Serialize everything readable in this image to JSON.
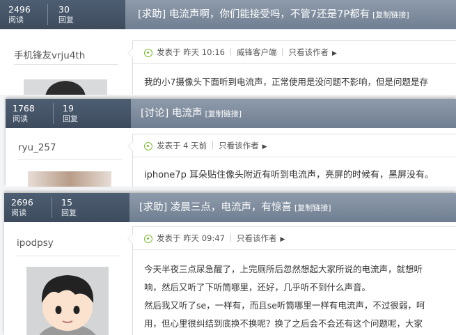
{
  "threads": [
    {
      "views": "2496",
      "views_label": "阅读",
      "replies": "30",
      "replies_label": "回复",
      "title": "[求助] 电流声啊，你们能接受吗，不管7还是7P都有",
      "copy_link": "[复制链接]",
      "author": "手机锋友vrju4th",
      "posted": "发表于 昨天 10:16",
      "client": "威锋客户端",
      "author_only": "只看该作者",
      "body_lines": [
        "我的小7摄像头下面听到电流声，正常使用是没问题不影响，但是问题是存"
      ]
    },
    {
      "views": "1768",
      "views_label": "阅读",
      "replies": "19",
      "replies_label": "回复",
      "title": "[讨论] 电流声",
      "copy_link": "[复制链接]",
      "author": "ryu_257",
      "posted": "发表于 4 天前",
      "author_only": "只看该作者",
      "body_lines": [
        "iphone7p 耳朵贴住像头附近有听到电流声，亮屏的时候有，黑屏没有。"
      ]
    },
    {
      "views": "2696",
      "views_label": "阅读",
      "replies": "15",
      "replies_label": "回复",
      "title": "[求助] 凌晨三点，电流声，有惊喜",
      "copy_link": "[复制链接]",
      "author": "ipodpsy",
      "posted": "发表于 昨天 09:47",
      "author_only": "只看该作者",
      "body_lines": [
        "今天半夜三点尿急醒了，上完厕所后忽然想起大家所说的电流声，就想听",
        "响，然后又听了下听筒哪里，还好，几乎听不到什么声音。",
        "然后我又听了se，一样有，而且se听筒哪里一样有电流声，不过很弱，呵",
        "用，但心里很纠结到底换不换呢？换了之后会不会还有这个问题呢，大家"
      ]
    }
  ],
  "colors": {
    "header_dark": "#3d4b5d",
    "header_light": "#7c8a9b",
    "accent_green": "#7dbb2f"
  },
  "icons": {
    "time": "clock-circle-icon",
    "more": "triangle-right-icon"
  }
}
